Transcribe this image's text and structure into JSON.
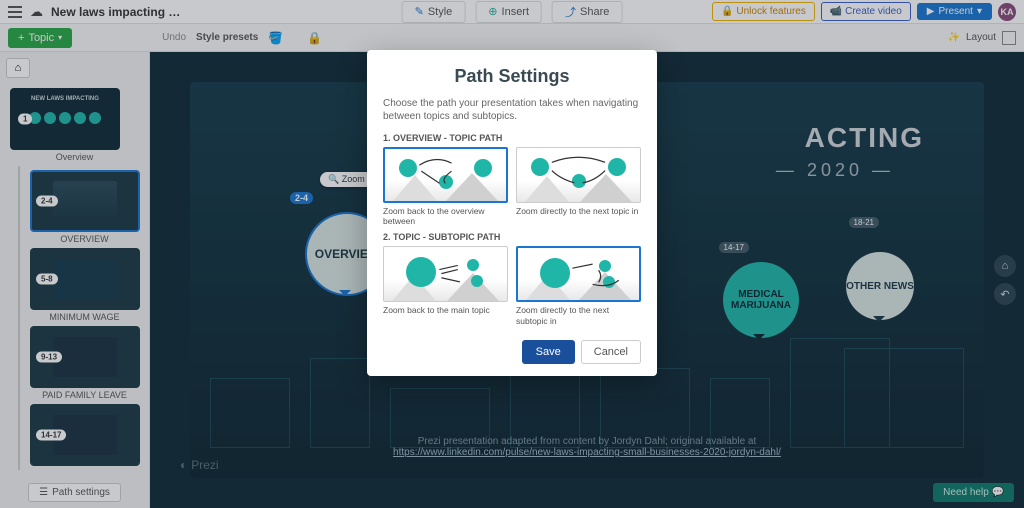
{
  "header": {
    "title": "New laws impacting …",
    "style": "Style",
    "insert": "Insert",
    "share": "Share",
    "unlock": "Unlock features",
    "create_video": "Create video",
    "present": "Present",
    "avatar": "KA"
  },
  "toolbar": {
    "topic": "Topic",
    "undo": "Undo",
    "presets": "Style presets",
    "layout": "Layout"
  },
  "sidebar": {
    "overview_label": "Overview",
    "path_settings": "Path settings",
    "items": [
      {
        "badge": "1",
        "label": "Overview"
      },
      {
        "badge": "2-4",
        "label": "OVERVIEW"
      },
      {
        "badge": "5-8",
        "label": "MINIMUM WAGE"
      },
      {
        "badge": "9-13",
        "label": "PAID FAMILY LEAVE"
      },
      {
        "badge": "14-17",
        "label": ""
      }
    ]
  },
  "canvas": {
    "title_line": "ACTING",
    "subtitle": "2020",
    "zoom_in": "Zoom In",
    "bubble1": "OVERVIEW",
    "badge1": "2-4",
    "bubble2": "MEDICAL MARIJUANA",
    "badge2": "14-17",
    "bubble3": "OTHER NEWS",
    "badge3": "18-21",
    "prezi": "Prezi",
    "credit": "Prezi presentation adapted from content by Jordyn Dahl; original available at",
    "credit_link": "https://www.linkedin.com/pulse/new-laws-impacting-small-businesses-2020-jordyn-dahl/",
    "help": "Need help"
  },
  "modal": {
    "title": "Path Settings",
    "desc": "Choose the path your presentation takes when navigating between topics and subtopics.",
    "section1": "1. OVERVIEW - TOPIC PATH",
    "opt1a": "Zoom back to the overview between",
    "opt1b": "Zoom directly to the next topic in",
    "section2": "2. TOPIC - SUBTOPIC PATH",
    "opt2a": "Zoom back to the main topic",
    "opt2b": "Zoom directly to the next subtopic in",
    "save": "Save",
    "cancel": "Cancel"
  }
}
